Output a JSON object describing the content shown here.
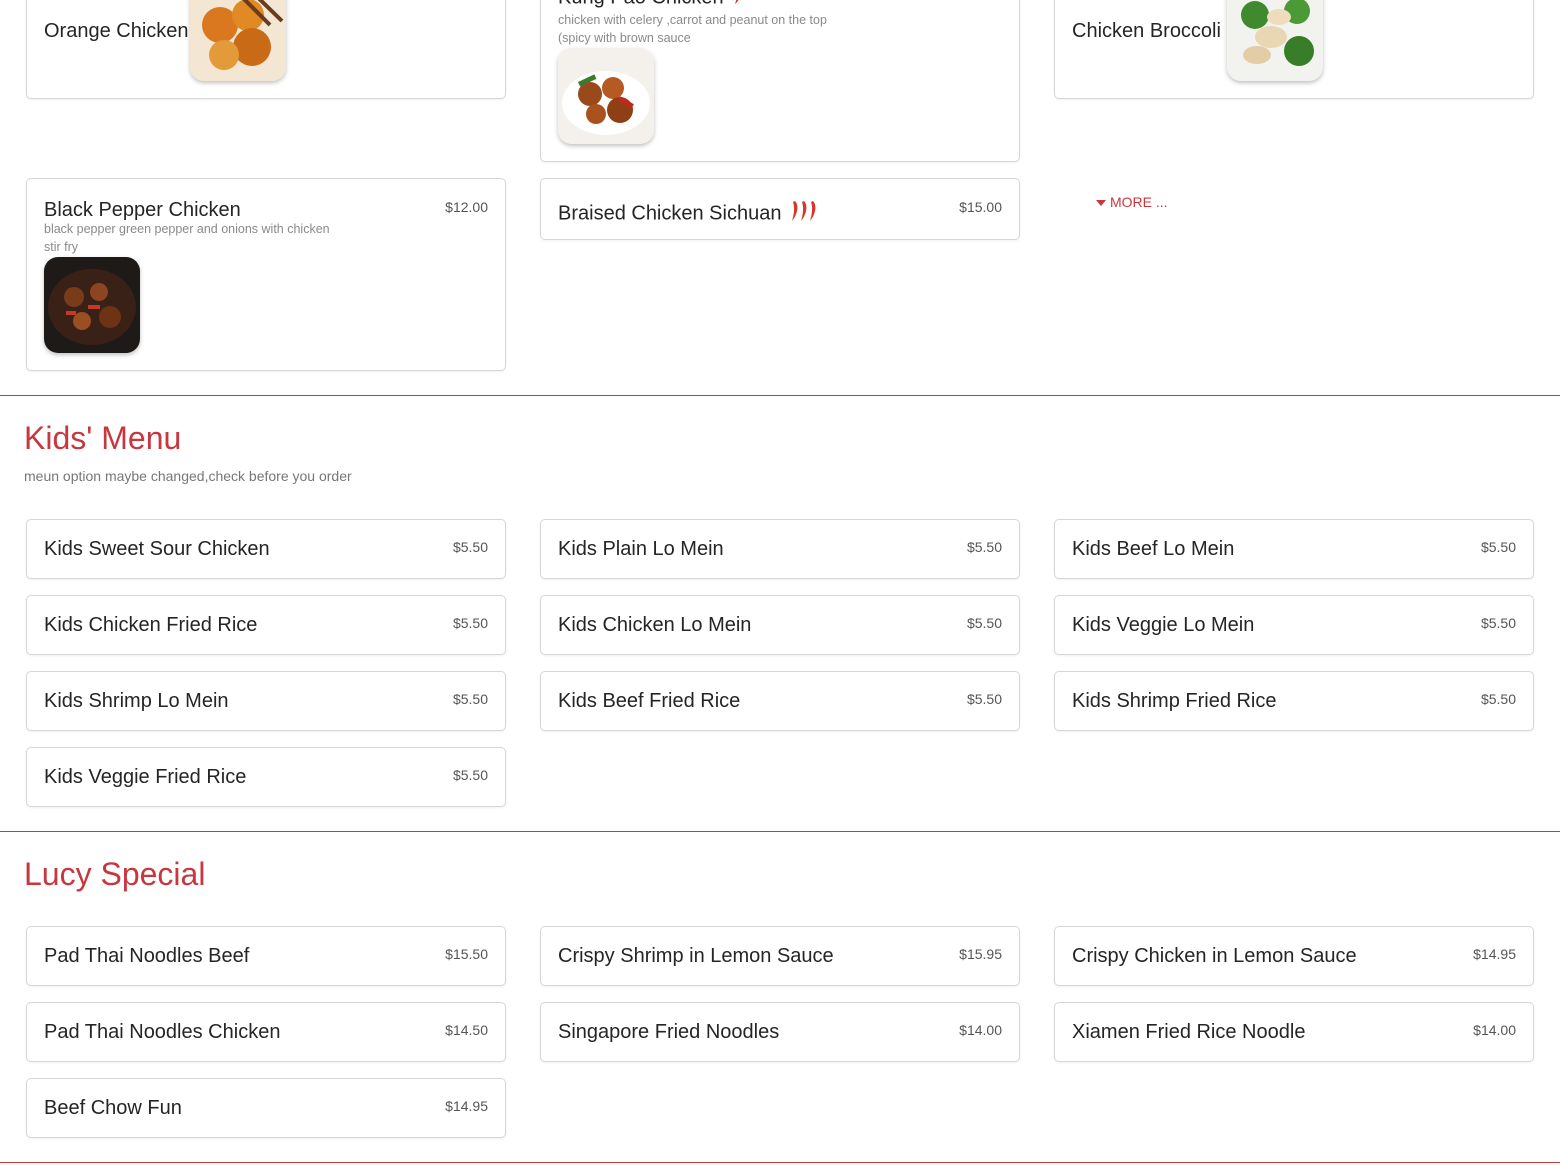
{
  "colors": {
    "accent": "#c9373e",
    "card_border": "#d7d7d7"
  },
  "top_section": {
    "items": [
      {
        "name": "Orange Chicken",
        "price": "",
        "image": "orange-chicken-photo"
      },
      {
        "name": "Kung Pao Chicken",
        "price": "",
        "desc": "chicken with celery ,carrot and peanut on the top (spicy with brown sauce",
        "image": "kung-pao-chicken-photo",
        "spicy": "pepper-icon"
      },
      {
        "name": "Chicken Broccoli",
        "price": "",
        "image": "chicken-broccoli-photo"
      },
      {
        "name": "Black Pepper Chicken",
        "price": "$12.00",
        "desc": "black pepper green pepper and onions with chicken stir fry",
        "image": "black-pepper-chicken-photo"
      },
      {
        "name": "Braised Chicken Sichuan",
        "price": "$15.00",
        "spicy": "triple-pepper-icon"
      }
    ],
    "more_label": "MORE ..."
  },
  "kids_menu": {
    "title": "Kids' Menu",
    "subtitle": "meun option maybe changed,check before you order",
    "items": [
      {
        "name": "Kids Sweet Sour Chicken",
        "price": "$5.50"
      },
      {
        "name": "Kids Plain Lo Mein",
        "price": "$5.50"
      },
      {
        "name": "Kids Beef Lo Mein",
        "price": "$5.50"
      },
      {
        "name": "Kids Chicken Fried Rice",
        "price": "$5.50"
      },
      {
        "name": "Kids Chicken Lo Mein",
        "price": "$5.50"
      },
      {
        "name": "Kids Veggie Lo Mein",
        "price": "$5.50"
      },
      {
        "name": "Kids Shrimp Lo Mein",
        "price": "$5.50"
      },
      {
        "name": "Kids Beef Fried Rice",
        "price": "$5.50"
      },
      {
        "name": "Kids Shrimp Fried Rice",
        "price": "$5.50"
      },
      {
        "name": "Kids Veggie Fried Rice",
        "price": "$5.50"
      }
    ]
  },
  "lucy_special": {
    "title": "Lucy Special",
    "items": [
      {
        "name": "Pad Thai Noodles Beef",
        "price": "$15.50"
      },
      {
        "name": "Crispy Shrimp in Lemon Sauce",
        "price": "$15.95"
      },
      {
        "name": "Crispy Chicken in Lemon Sauce",
        "price": "$14.95"
      },
      {
        "name": "Pad Thai Noodles Chicken",
        "price": "$14.50"
      },
      {
        "name": "Singapore Fried Noodles",
        "price": "$14.00"
      },
      {
        "name": "Xiamen Fried Rice Noodle",
        "price": "$14.00"
      },
      {
        "name": "Beef Chow Fun",
        "price": "$14.95"
      }
    ]
  }
}
